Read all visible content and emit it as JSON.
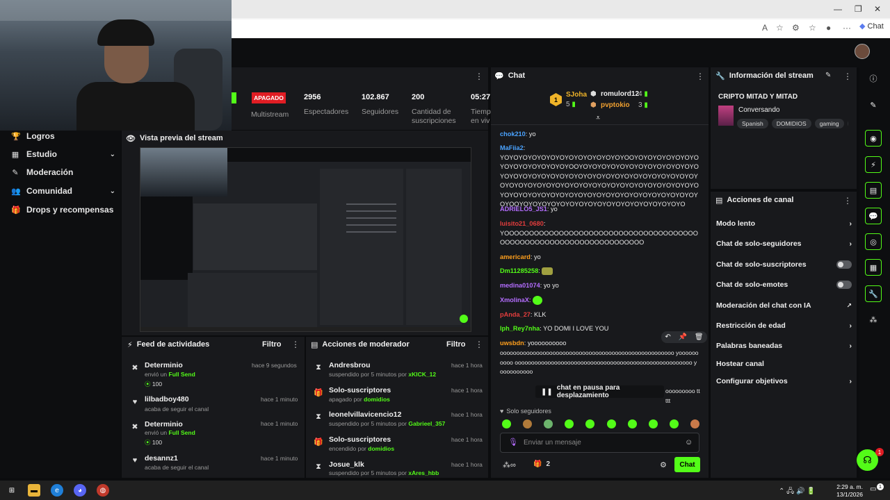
{
  "browser": {
    "copilot_label": "Chat"
  },
  "sidebar": {
    "items": [
      {
        "label": "Logros",
        "icon": "trophy-icon"
      },
      {
        "label": "Estudio",
        "icon": "wrench-icon"
      },
      {
        "label": "Moderación",
        "icon": "wrench-icon"
      },
      {
        "label": "Comunidad",
        "icon": "users-icon"
      },
      {
        "label": "Drops y recompensas",
        "icon": "gift-icon"
      }
    ]
  },
  "stats": {
    "status": "APAGADO",
    "multistream": "Multistream",
    "viewers_value": "2956",
    "viewers_label": "Espectadores",
    "followers_value": "102.867",
    "followers_label": "Seguidores",
    "subs_value": "200",
    "subs_label1": "Cantidad de",
    "subs_label2": "suscripciones",
    "time_value": "05:27",
    "time_label1": "Tiemp",
    "time_label2": "en viv"
  },
  "preview": {
    "title": "Vista previa del stream"
  },
  "activity_feed": {
    "title": "Feed de actividades",
    "filter": "Filtro",
    "items": [
      {
        "name": "Determinio",
        "time": "hace 9 segundos",
        "sub_prefix": "envió un",
        "sub_highlight": "Full Send",
        "amount": "100"
      },
      {
        "name": "lilbadboy480",
        "time": "hace 1 minuto",
        "sub": "acaba de seguir el canal"
      },
      {
        "name": "Determinio",
        "time": "hace 1 minuto",
        "sub_prefix": "envió un",
        "sub_highlight": "Full Send",
        "amount": "100"
      },
      {
        "name": "desannz1",
        "time": "hace 1 minuto",
        "sub": "acaba de seguir el canal"
      }
    ]
  },
  "mod_actions": {
    "title": "Acciones de moderador",
    "filter": "Filtro",
    "items": [
      {
        "name": "Andresbrou",
        "time": "hace 1 hora",
        "sub": "suspendido por 5 minutos por",
        "by": "xKICK_12"
      },
      {
        "name": "Solo-suscriptores",
        "time": "hace 1 hora",
        "sub": "apagado por",
        "by": "domidios"
      },
      {
        "name": "leonelvillavicencio12",
        "time": "hace 1 hora",
        "sub": "suspendido por 5 minutos por",
        "by": "Gabrieel_357"
      },
      {
        "name": "Solo-suscriptores",
        "time": "hace 1 hora",
        "sub": "encendido por",
        "by": "domidios"
      },
      {
        "name": "Josue_klk",
        "time": "hace 1 hora",
        "sub": "suspendido por 5 minutos por",
        "by": "xAres_hbb"
      }
    ]
  },
  "chat": {
    "title": "Chat",
    "top_gifters": [
      {
        "name": "SJoha",
        "count": "5",
        "rank": "1"
      },
      {
        "name": "romulord12",
        "count": "4"
      },
      {
        "name": "pvptokio",
        "count": "3"
      }
    ],
    "messages": [
      {
        "user": "chok210",
        "color": "#4aa3ff",
        "text": "yo"
      },
      {
        "user": "MaFiia2",
        "color": "#4aa3ff",
        "text": "YOYOYOYOYOYOYOYOYOYOYOYOYOYOOYOYOYOYOYOYOYOYOYOYOYOYOYOYOYOOYOYOYOYOYOYOYOYOYOYOYOYOYOYOYOYOYOYOYOYOYOYOYOYOYOYOYOYOYOYOYOYOYOYOYOYOYOYOYOYOYOYOYOYOYOYOYOYOYOYOYOYOYOYOYOYOYOYOYOYOYOYOYOYOYOYOYOYOYOYOYOYOYOYOYOYOYOYOYOOYOYOYOYOYOYOYOYOYOYOYOYOYOYOYOYOYOYO"
      },
      {
        "user": "ADRIELO5_JS1",
        "color": "#b46dff",
        "text": "yo"
      },
      {
        "user": "luisito21_0680",
        "color": "#e33d3d",
        "text": "YOOOOOOOOOOOOOOOOOOOOOOOOOOOOOOOOOOOOOOOOOOOOOOOOOOOOOOOOOOOOOOOOOOOO"
      },
      {
        "user": "americard",
        "color": "#ff9f1c",
        "text": "yo"
      },
      {
        "user": "Dm11285258",
        "color": "#53fc18",
        "text": ""
      },
      {
        "user": "medina01074",
        "color": "#b46dff",
        "text": "yo yo"
      },
      {
        "user": "XmolinaX",
        "color": "#b46dff",
        "text": ""
      },
      {
        "user": "pAnda_27",
        "color": "#e33d3d",
        "text": "KLK"
      },
      {
        "user": "lph_Rey7nha",
        "color": "#53fc18",
        "text": "YO DOMI I LOVE YOU"
      },
      {
        "user": "uwsbdn",
        "color": "#ff9f1c",
        "text": "yoooooooooo"
      }
    ],
    "long_msg": "ooooooooooooooooooooooooooooooooooooooooooooooooooooo yoooooooooo oooooooooooooooooooooooooooooooooooooooooooooooooooooo yoooooooooo",
    "long_msg_tail": "ooooooooo ttttt",
    "paused": "chat en pausa para desplazamiento",
    "followers_only": "Solo seguidores",
    "input_placeholder": "Enviar un mensaje",
    "count": "2",
    "send": "Chat"
  },
  "stream_info": {
    "title": "Información del stream",
    "stream_title": "CRIPTO MITAD Y MITAD",
    "category": "Conversando",
    "tags": [
      "Spanish",
      "DOMIDIOS",
      "gaming",
      "gi"
    ]
  },
  "channel_actions": {
    "title": "Acciones de canal",
    "items": [
      {
        "label": "Modo lento",
        "control": "chevron"
      },
      {
        "label": "Chat de solo-seguidores",
        "control": "chevron"
      },
      {
        "label": "Chat de solo-suscriptores",
        "control": "toggle"
      },
      {
        "label": "Chat de solo-emotes",
        "control": "toggle"
      },
      {
        "label": "Moderación del chat con IA",
        "control": "external"
      },
      {
        "label": "Restricción de edad",
        "control": "chevron"
      },
      {
        "label": "Palabras baneadas",
        "control": "chevron"
      },
      {
        "label": "Hostear canal",
        "control": "none"
      },
      {
        "label": "Configurar objetivos",
        "control": "chevron"
      }
    ]
  },
  "support_badge": "1",
  "taskbar": {
    "time": "2:29 a. m.",
    "date": "13/1/2026",
    "notif": "1"
  }
}
